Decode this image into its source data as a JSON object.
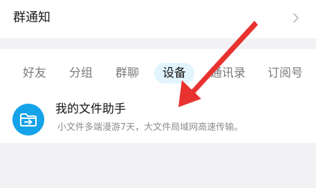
{
  "group_notice": {
    "label": "群通知"
  },
  "tabs": [
    {
      "label": "好友",
      "active": false
    },
    {
      "label": "分组",
      "active": false
    },
    {
      "label": "群聊",
      "active": false
    },
    {
      "label": "设备",
      "active": true
    },
    {
      "label": "通讯录",
      "active": false
    },
    {
      "label": "订阅号",
      "active": false
    }
  ],
  "file_assistant": {
    "title": "我的文件助手",
    "description": "小文件多端漫游7天，大文件局域网高速传输。",
    "icon": "file-transfer-icon"
  },
  "colors": {
    "accent": "#14a3e8",
    "active_tab_bg": "#e2f4fd",
    "annotation_arrow": "#e8322f",
    "page_bg": "#f2f2f4"
  }
}
